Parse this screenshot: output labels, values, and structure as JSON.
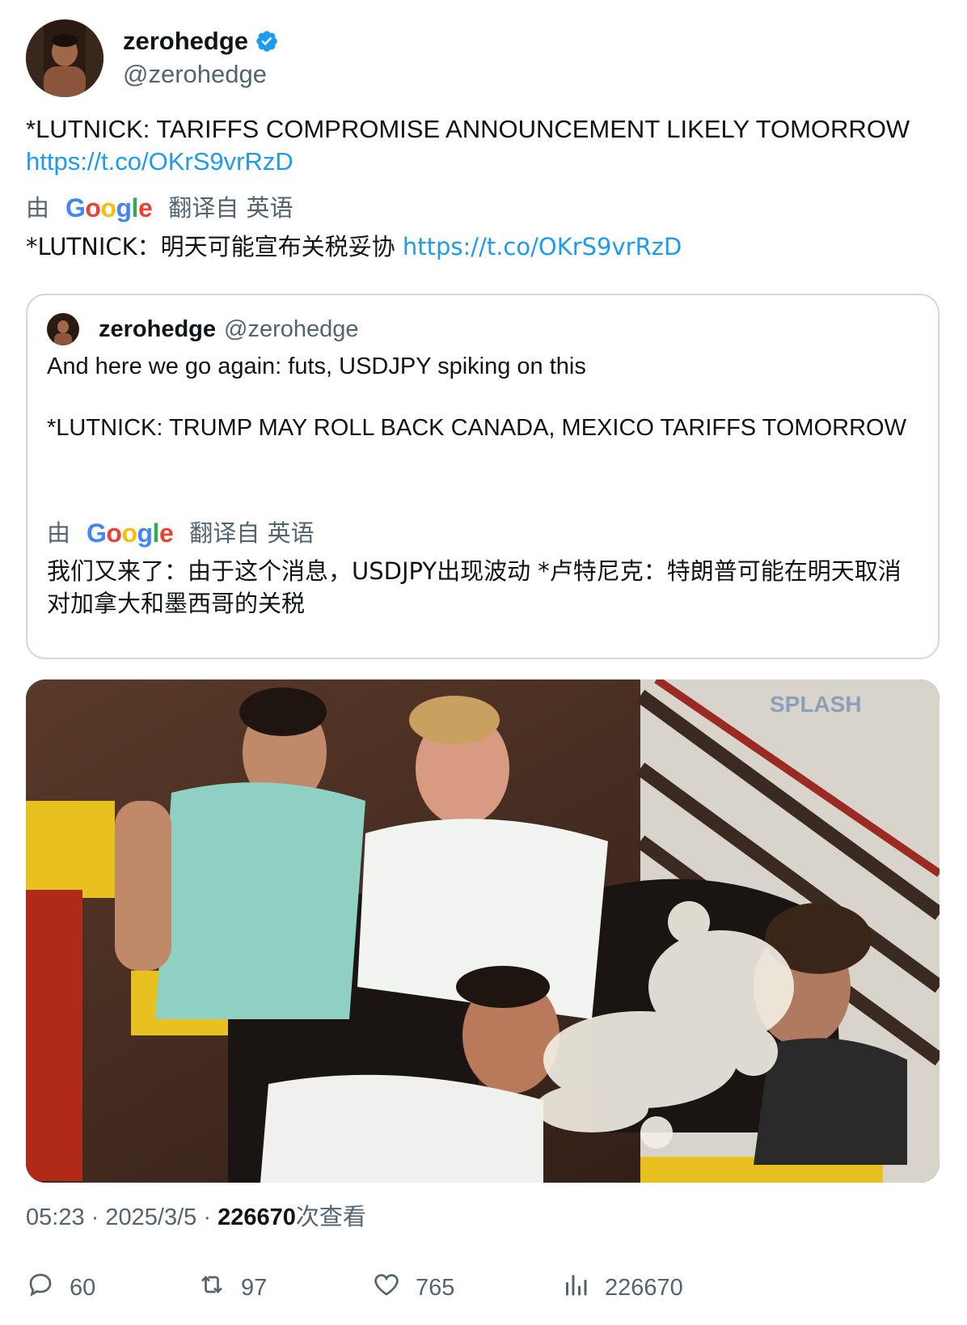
{
  "author": {
    "name": "zerohedge",
    "handle": "@zerohedge",
    "verified": true
  },
  "tweet": {
    "text": "*LUTNICK: TARIFFS COMPROMISE ANNOUNCEMENT LIKELY TOMORROW",
    "link": "https://t.co/OKrS9vrRzD",
    "translation": {
      "by": "由",
      "brand": "Google",
      "from": "翻译自 英语",
      "text": "*LUTNICK：明天可能宣布关税妥协",
      "link": "https://t.co/OKrS9vrRzD"
    }
  },
  "quote": {
    "name": "zerohedge",
    "handle": "@zerohedge",
    "line1": "And here we go again: futs, USDJPY spiking on this",
    "line2": "*LUTNICK: TRUMP MAY ROLL BACK CANADA, MEXICO TARIFFS TOMORROW",
    "translation": {
      "by": "由",
      "brand": "Google",
      "from": "翻译自 英语",
      "text": "我们又来了：由于这个消息，USDJPY出现波动 *卢特尼克：特朗普可能在明天取消对加拿大和墨西哥的关税"
    }
  },
  "media": {
    "watermark": "SPLASH"
  },
  "meta": {
    "time": "05:23",
    "sep1": "·",
    "date": "2025/3/5",
    "sep2": "·",
    "views": "226670",
    "views_label": "次查看"
  },
  "actions": {
    "replies": "60",
    "retweets": "97",
    "likes": "765",
    "views": "226670"
  },
  "colors": {
    "link": "#1d9bf0",
    "muted": "#536471",
    "text": "#0f1419",
    "verified": "#1d9bf0",
    "border": "#cfd9de"
  },
  "icons": [
    "verified-badge-icon",
    "reply-icon",
    "retweet-icon",
    "like-icon",
    "views-icon"
  ]
}
